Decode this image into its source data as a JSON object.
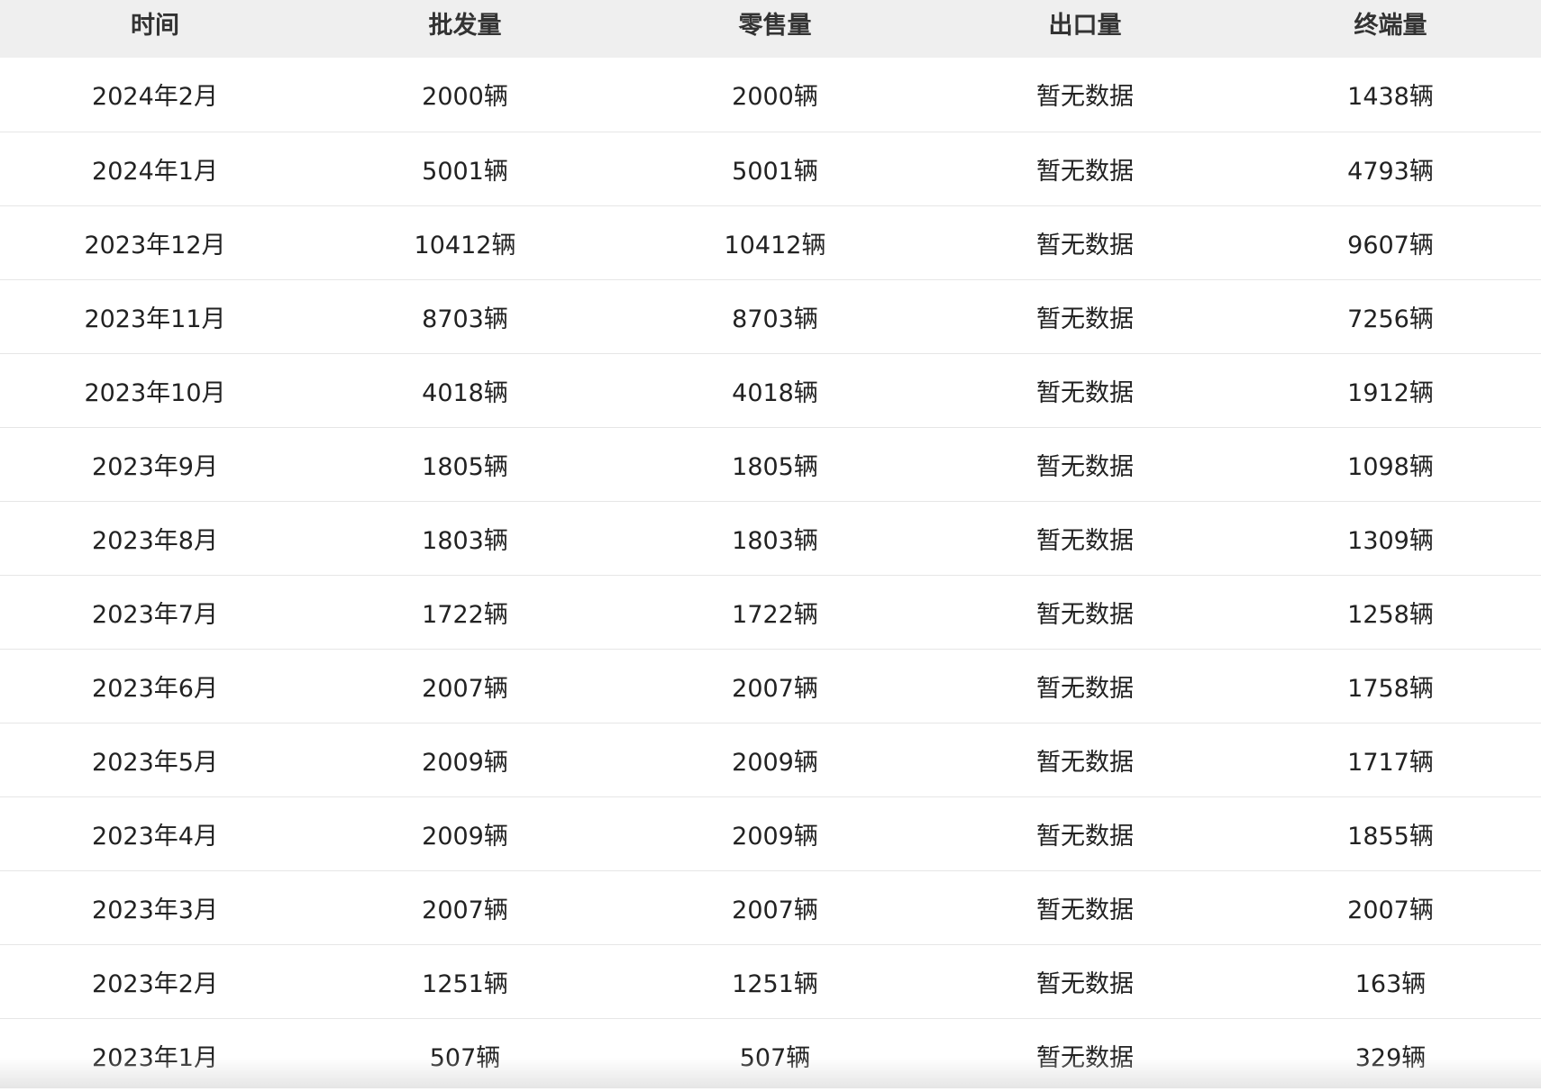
{
  "table": {
    "headers": [
      "时间",
      "批发量",
      "零售量",
      "出口量",
      "终端量"
    ],
    "rows": [
      [
        "2024年2月",
        "2000辆",
        "2000辆",
        "暂无数据",
        "1438辆"
      ],
      [
        "2024年1月",
        "5001辆",
        "5001辆",
        "暂无数据",
        "4793辆"
      ],
      [
        "2023年12月",
        "10412辆",
        "10412辆",
        "暂无数据",
        "9607辆"
      ],
      [
        "2023年11月",
        "8703辆",
        "8703辆",
        "暂无数据",
        "7256辆"
      ],
      [
        "2023年10月",
        "4018辆",
        "4018辆",
        "暂无数据",
        "1912辆"
      ],
      [
        "2023年9月",
        "1805辆",
        "1805辆",
        "暂无数据",
        "1098辆"
      ],
      [
        "2023年8月",
        "1803辆",
        "1803辆",
        "暂无数据",
        "1309辆"
      ],
      [
        "2023年7月",
        "1722辆",
        "1722辆",
        "暂无数据",
        "1258辆"
      ],
      [
        "2023年6月",
        "2007辆",
        "2007辆",
        "暂无数据",
        "1758辆"
      ],
      [
        "2023年5月",
        "2009辆",
        "2009辆",
        "暂无数据",
        "1717辆"
      ],
      [
        "2023年4月",
        "2009辆",
        "2009辆",
        "暂无数据",
        "1855辆"
      ],
      [
        "2023年3月",
        "2007辆",
        "2007辆",
        "暂无数据",
        "2007辆"
      ],
      [
        "2023年2月",
        "1251辆",
        "1251辆",
        "暂无数据",
        "163辆"
      ],
      [
        "2023年1月",
        "507辆",
        "507辆",
        "暂无数据",
        "329辆"
      ]
    ]
  }
}
